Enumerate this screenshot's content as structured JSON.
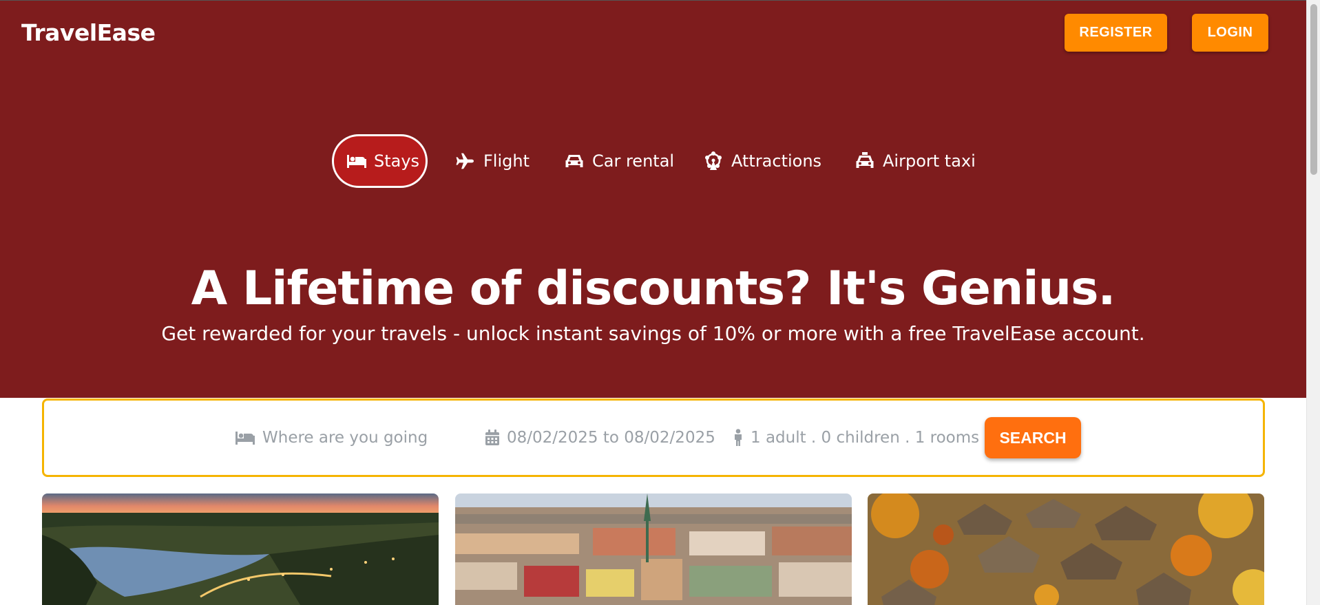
{
  "brand": {
    "name": "TravelEase"
  },
  "header": {
    "register_label": "REGISTER",
    "login_label": "LOGIN"
  },
  "tabs": [
    {
      "label": "Stays",
      "icon": "bed-icon",
      "active": true
    },
    {
      "label": "Flight",
      "icon": "plane-icon",
      "active": false
    },
    {
      "label": "Car rental",
      "icon": "car-icon",
      "active": false
    },
    {
      "label": "Attractions",
      "icon": "ferris-wheel-icon",
      "active": false
    },
    {
      "label": "Airport taxi",
      "icon": "taxi-icon",
      "active": false
    }
  ],
  "hero": {
    "headline": "A Lifetime of discounts? It's Genius.",
    "subline": "Get rewarded for your travels - unlock instant savings of 10% or more with a free TravelEase account."
  },
  "search": {
    "destination_placeholder": "Where are you going?",
    "dates": "08/02/2025 to 08/02/2025",
    "guests": "1 adult . 0 children . 1 rooms",
    "button_label": "SEARCH"
  },
  "cards": [
    {
      "image": "sunset-river-bridge-photo"
    },
    {
      "image": "city-aerial-photo"
    },
    {
      "image": "autumn-village-photo"
    }
  ],
  "colors": {
    "hero_bg": "#7e1c1d",
    "accent_orange": "#ff8a00",
    "search_orange": "#ff6f0f",
    "active_tab_bg": "#b71c1c",
    "search_border": "#f5b400",
    "placeholder_gray": "#9aa0a6"
  }
}
